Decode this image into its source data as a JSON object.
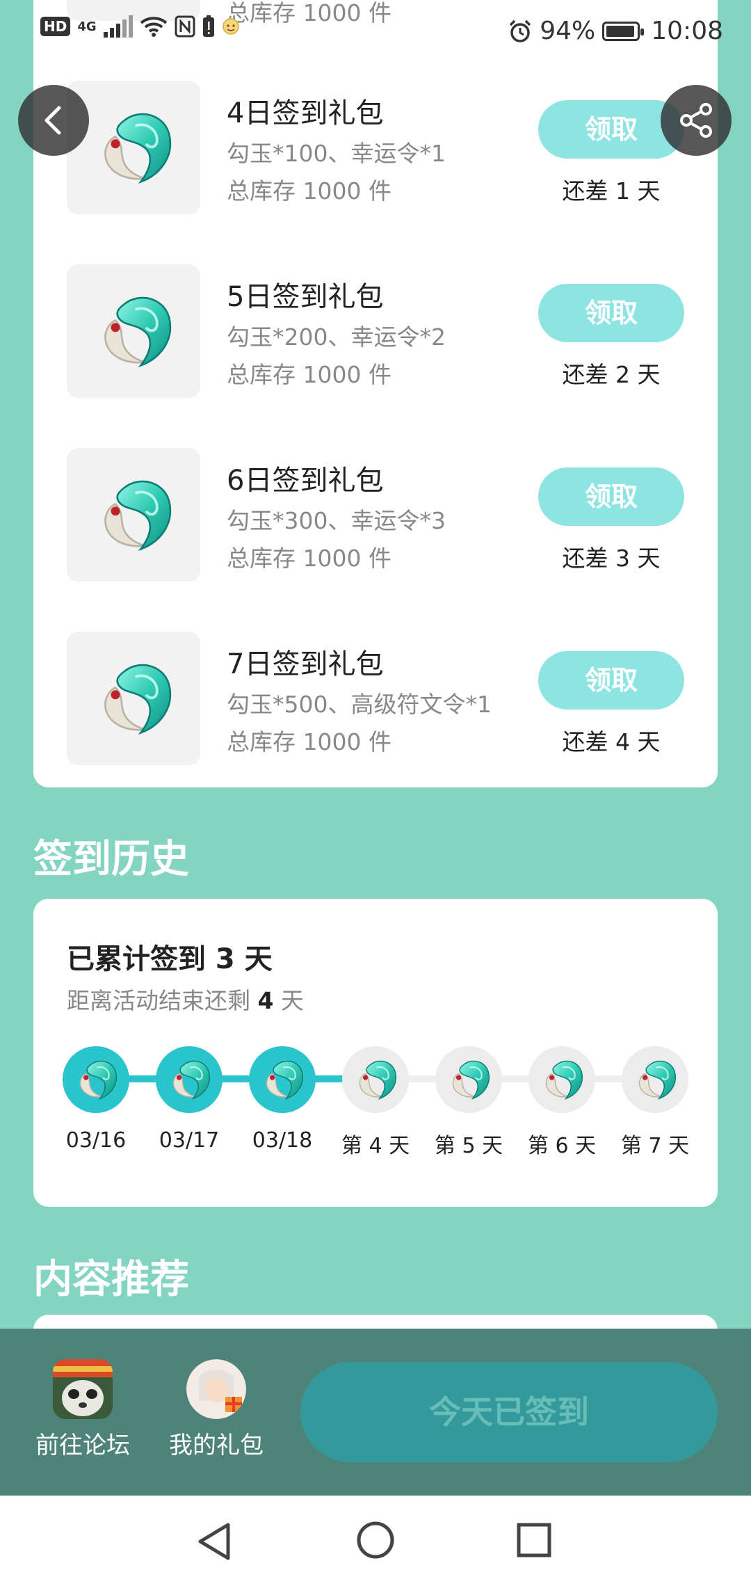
{
  "status_bar": {
    "hd": "HD",
    "network": "4G",
    "battery": "94%",
    "time": "10:08"
  },
  "partial_top": {
    "stock": "总库存 1000 件"
  },
  "rewards": [
    {
      "title": "4日签到礼包",
      "items": "勾玉*100、幸运令*1",
      "stock": "总库存 1000 件",
      "button": "领取",
      "remaining": "还差 1 天"
    },
    {
      "title": "5日签到礼包",
      "items": "勾玉*200、幸运令*2",
      "stock": "总库存 1000 件",
      "button": "领取",
      "remaining": "还差 2 天"
    },
    {
      "title": "6日签到礼包",
      "items": "勾玉*300、幸运令*3",
      "stock": "总库存 1000 件",
      "button": "领取",
      "remaining": "还差 3 天"
    },
    {
      "title": "7日签到礼包",
      "items": "勾玉*500、高级符文令*1",
      "stock": "总库存 1000 件",
      "button": "领取",
      "remaining": "还差 4 天"
    }
  ],
  "history": {
    "section_title": "签到历史",
    "total": "已累计签到 3 天",
    "remain_prefix": "距离活动结束还剩 ",
    "remain_days": "4",
    "remain_suffix": " 天",
    "days": [
      {
        "label": "03/16",
        "done": true
      },
      {
        "label": "03/17",
        "done": true
      },
      {
        "label": "03/18",
        "done": true
      },
      {
        "label": "第 4 天",
        "done": false
      },
      {
        "label": "第 5 天",
        "done": false
      },
      {
        "label": "第 6 天",
        "done": false
      },
      {
        "label": "第 7 天",
        "done": false
      }
    ]
  },
  "recommend": {
    "section_title": "内容推荐"
  },
  "bottom_bar": {
    "forum_label": "前往论坛",
    "gift_label": "我的礼包",
    "signed_label": "今天已签到"
  },
  "colors": {
    "page_bg": "#84d4c2",
    "accent": "#2ac4cd",
    "claim_button": "#8ee3e3",
    "bottom_bar": "#4e8379",
    "signed_button": "#33999b"
  }
}
